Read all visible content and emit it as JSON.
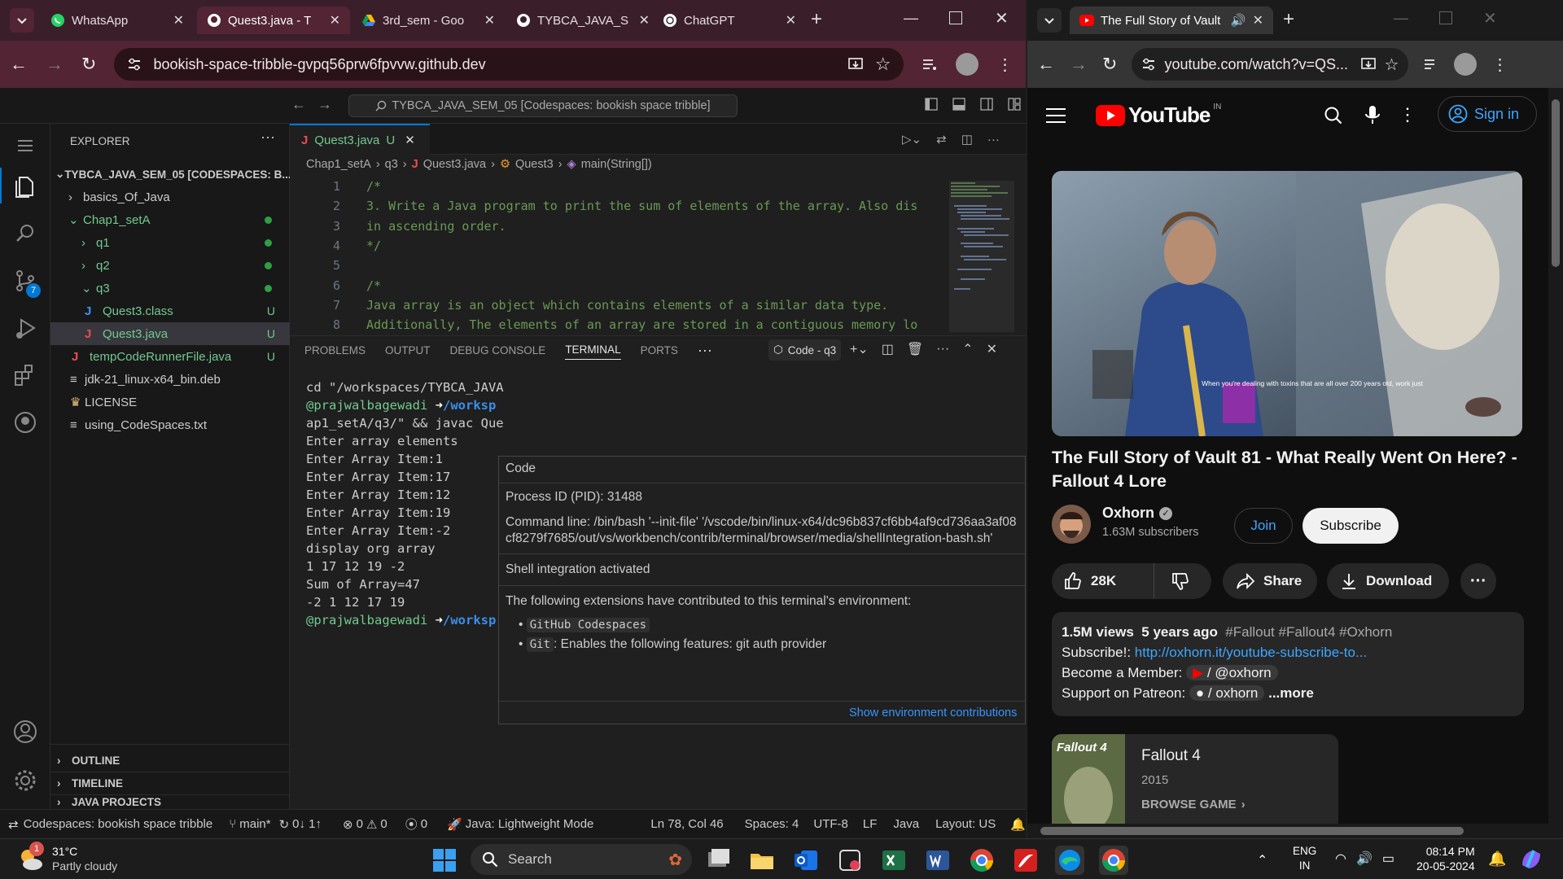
{
  "left_browser": {
    "tabs": [
      {
        "label": "WhatsApp",
        "icon": "whatsapp-icon"
      },
      {
        "label": "Quest3.java - T",
        "icon": "github-icon"
      },
      {
        "label": "3rd_sem - Goo",
        "icon": "google-drive-icon"
      },
      {
        "label": "TYBCA_JAVA_S",
        "icon": "github-icon"
      },
      {
        "label": "ChatGPT",
        "icon": "chatgpt-icon"
      }
    ],
    "url": "bookish-space-tribble-gvpq56prw6fpvvw.github.dev"
  },
  "vscode": {
    "command_center": "TYBCA_JAVA_SEM_05 [Codespaces: bookish space tribble]",
    "explorer_title": "EXPLORER",
    "workspace_title": "TYBCA_JAVA_SEM_05 [CODESPACES: B...",
    "tree": [
      "basics_Of_Java",
      "Chap1_setA",
      "q1",
      "q2",
      "q3",
      "Quest3.class",
      "Quest3.java",
      "tempCodeRunnerFile.java",
      "jdk-21_linux-x64_bin.deb",
      "LICENSE",
      "using_CodeSpaces.txt"
    ],
    "untracked_badge": "U",
    "scm_badge": "7",
    "sections": [
      "OUTLINE",
      "TIMELINE",
      "JAVA PROJECTS"
    ],
    "editor_tab": "Quest3.java",
    "editor_tab_badge": "U",
    "breadcrumb": [
      "Chap1_setA",
      "q3",
      "Quest3.java",
      "Quest3",
      "main(String[])"
    ],
    "code_lines": [
      "/*",
      "3. Write a Java program to print the sum of elements of the array. Also dis",
      "in ascending order.",
      "*/",
      "",
      "/*",
      "Java array is an object which contains elements of a similar data type.",
      "Additionally, The elements of an array are stored in a contiguous memory lo"
    ],
    "line_numbers": [
      "1",
      "2",
      "3",
      "4",
      "5",
      "6",
      "7",
      "8"
    ],
    "panel_tabs": [
      "PROBLEMS",
      "OUTPUT",
      "DEBUG CONSOLE",
      "TERMINAL",
      "PORTS"
    ],
    "terminal_label": "Code - q3",
    "terminal": {
      "cd_line": "cd \"/workspaces/TYBCA_JAVA",
      "prompt_user": "@prajwalbagewadi",
      "prompt_arrow": "➜",
      "prompt_path": "/worksp",
      "prompt_path2": "/worksp",
      "lines": [
        "ap1_setA/q3/\" && javac Que",
        "Enter array elements",
        "Enter Array Item:1",
        "Enter Array Item:17",
        "Enter Array Item:12",
        "Enter Array Item:19",
        "Enter Array Item:-2",
        "display org array",
        "1 17 12 19 -2",
        "Sum of Array=47",
        "-2 1 12 17 19"
      ]
    },
    "hover": {
      "title": "Code",
      "pid": "Process ID (PID): 31488",
      "cmd": "Command line: /bin/bash '--init-file' '/vscode/bin/linux-x64/dc96b837cf6bb4af9cd736aa3af08cf8279f7685/out/vs/workbench/contrib/terminal/browser/media/shellIntegration-bash.sh'",
      "shell": "Shell integration activated",
      "ext_intro": "The following extensions have contributed to this terminal's environment:",
      "ext1": "GitHub Codespaces",
      "ext2_name": "Git",
      "ext2_desc": ": Enables the following features: git auth provider",
      "link": "Show environment contributions"
    },
    "status": {
      "remote": "Codespaces: bookish space tribble",
      "branch": "main*",
      "sync": "0↓ 1↑",
      "errors": "0",
      "warnings": "0",
      "ports": "0",
      "java": "Java: Lightweight Mode",
      "position": "Ln 78, Col 46",
      "spaces": "Spaces: 4",
      "encoding": "UTF-8",
      "eol": "LF",
      "language": "Java",
      "layout": "Layout: US"
    }
  },
  "right_browser": {
    "tab": "The Full Story of Vault 81 - V",
    "url": "youtube.com/watch?v=QS...",
    "logo_text": "YouTube",
    "logo_region": "IN",
    "sign_in": "Sign in",
    "video_caption": "When you're dealing with toxins that are all over 200 years old, work just",
    "video_title": "The Full Story of Vault 81 - What Really Went On Here? - Fallout 4 Lore",
    "channel": "Oxhorn",
    "subscribers": "1.63M subscribers",
    "join": "Join",
    "subscribe": "Subscribe",
    "likes": "28K",
    "share": "Share",
    "download": "Download",
    "views": "1.5M views",
    "age": "5 years ago",
    "hashtags": "#Fallout #Fallout4 #Oxhorn",
    "subscribe_prefix": "Subscribe!:",
    "subscribe_link": "http://oxhorn.it/youtube-subscribe-to...",
    "member_prefix": "Become a Member:",
    "member_handle": "/ @oxhorn",
    "patreon_prefix": "Support on Patreon:",
    "patreon_handle": "/ oxhorn",
    "more": "...more",
    "game_title": "Fallout 4",
    "game_year": "2015",
    "game_browse": "BROWSE GAME",
    "game_cover_text": "Fallout 4"
  },
  "taskbar": {
    "weather_temp": "31°C",
    "weather_desc": "Partly cloudy",
    "weather_badge": "1",
    "search": "Search",
    "lang1": "ENG",
    "lang2": "IN",
    "time": "08:14 PM",
    "date": "20-05-2024"
  },
  "colors": {
    "accent_blue": "#0078d4",
    "yt_red": "#ff0000",
    "git_green": "#73c991"
  }
}
